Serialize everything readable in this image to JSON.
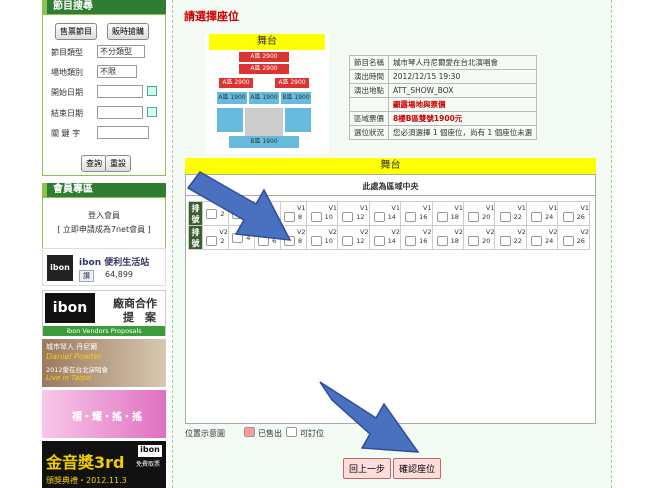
{
  "sidebar": {
    "program_search": {
      "title": "節目搜尋",
      "tab_program": "售票節目",
      "tab_times": "販時搶購",
      "category_label": "節目類型",
      "category_value": "不分類型",
      "venue_label": "場地類別",
      "venue_value": "不限",
      "start_label": "開始日期",
      "end_label": "結束日期",
      "keyword_label": "關 鍵 字",
      "search_btn": "查詢",
      "reset_btn": "重設"
    },
    "member": {
      "title": "會員專區",
      "login": "登入會員",
      "signup": "[ 立即申請成為7net會員 ]"
    },
    "ibon": {
      "logo": "ibon",
      "name": "ibon 便利生活站",
      "like": "讚",
      "likes": "64,899"
    },
    "partner": {
      "logo": "ibon",
      "line1": "廠商合作",
      "line2": "提　案",
      "caption": "ibon Vendors Proposals"
    },
    "ad1": {
      "line1": "城市琴人 丹尼爾",
      "line2": "Daniel Powter",
      "line3": "2012愛在台北演唱會",
      "line4": "Live in Taipei"
    },
    "ad2": {
      "text": "褶・耀・搖・搖"
    },
    "ad3": {
      "text": "金音獎3rd",
      "logo": "ibon",
      "free": "免費取票",
      "date": "頒獎典禮・2012.11.3"
    }
  },
  "main": {
    "heading": "請選擇座位",
    "map_stage": "舞台",
    "map_labels": [
      "7樓",
      "A區 2900",
      "A區 1900",
      "A區 1900",
      "B區 1900",
      "A區 2900",
      "A區 2900",
      "A區 2900",
      "B區 1900",
      "5樓B 1900",
      "2樓",
      "A區 1900",
      "B區 1900"
    ],
    "info": [
      [
        "節目名稱",
        "城市琴人丹尼爾愛在台北演唱會"
      ],
      [
        "演出時間",
        "2012/12/15 19:30"
      ],
      [
        "演出地點",
        "ATT_SHOW_BOX"
      ],
      [
        "",
        "顯露場地與票價"
      ],
      [
        "區域票價",
        "8樓B區雙號1900元"
      ],
      [
        "選位狀況",
        "您必須選擇 1 個座位，尚有 1 個座位未選"
      ]
    ],
    "stage_bar": "舞台",
    "center_title": "此處為區域中央",
    "row_label": "排號",
    "row1": [
      [
        "",
        "2"
      ],
      [
        "",
        "4"
      ],
      [
        "",
        "6"
      ],
      [
        "V1",
        "8"
      ],
      [
        "V1",
        "10"
      ],
      [
        "V1",
        "12"
      ],
      [
        "V1",
        "14"
      ],
      [
        "V1",
        "16"
      ],
      [
        "V1",
        "18"
      ],
      [
        "V1",
        "20"
      ],
      [
        "V1",
        "22"
      ],
      [
        "V1",
        "24"
      ],
      [
        "V1",
        "26"
      ]
    ],
    "row2": [
      [
        "V2",
        "2"
      ],
      [
        "",
        "4"
      ],
      [
        "V2",
        "6"
      ],
      [
        "V2",
        "8"
      ],
      [
        "V2",
        "10"
      ],
      [
        "V2",
        "12"
      ],
      [
        "V2",
        "14"
      ],
      [
        "V2",
        "16"
      ],
      [
        "V2",
        "18"
      ],
      [
        "V2",
        "20"
      ],
      [
        "V2",
        "22"
      ],
      [
        "V2",
        "24"
      ],
      [
        "V2",
        "26"
      ]
    ],
    "legend_label": "位置示意圖",
    "legend_sold": "已售出",
    "legend_avail": "可訂位",
    "back_btn": "回上一步",
    "confirm_btn": "確認座位"
  }
}
